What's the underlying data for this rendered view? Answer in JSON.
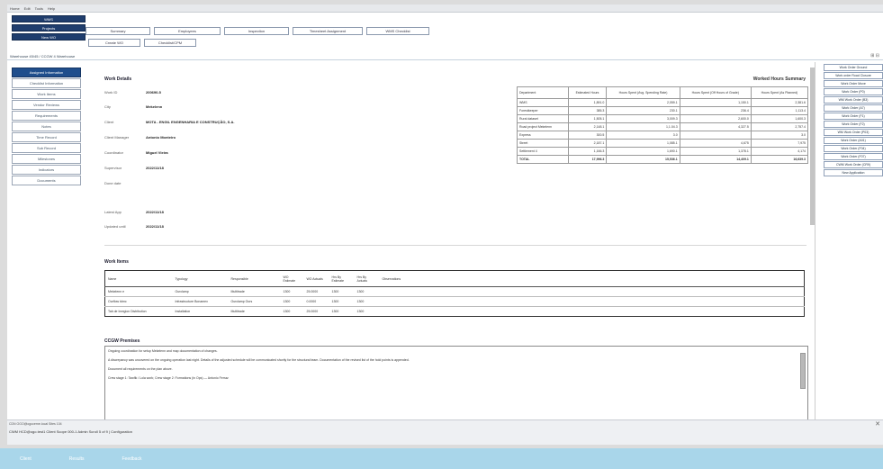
{
  "menubar": [
    "Home",
    "Edit",
    "Tools",
    "Help"
  ],
  "side_top_buttons": [
    "WMS",
    "Projects",
    "New WO"
  ],
  "tabs_row1": [
    "Summary",
    "Employees",
    "Inspection",
    "Timesheet Assignment",
    "WMS Checklist"
  ],
  "tabs_row2": [
    "Create WO",
    "Checklist/CPM"
  ],
  "breadcrumb": "Warehouse 45/45 / CCGW 4 Warehouse",
  "top_right": "⊞ ⊟",
  "leftnav": [
    "Assigned Information",
    "Checklist Information",
    "Work Items",
    "Vendor Reviews",
    "Requirements",
    "Notes",
    "Time Record",
    "Sub Record",
    "Milestones",
    "Indicators",
    "Documents"
  ],
  "work_details": {
    "title": "Work Details",
    "fields": [
      {
        "label": "Work ID",
        "value": "200690-5"
      },
      {
        "label": "City",
        "value": "Mekelenn"
      },
      {
        "label": "Client",
        "value": "MOTA - ENGIL ENGENHARIA E CONSTRUÇÃO, S.A."
      },
      {
        "label": "Client Manager",
        "value": "Antonio Monteiro"
      },
      {
        "label": "Coordinator",
        "value": "Miguel Vieira"
      },
      {
        "label": "Supervisor",
        "value": "2022/11/18"
      },
      {
        "label": "Done date",
        "value": ""
      },
      {
        "label": "Latest App",
        "value": "2022/11/18"
      },
      {
        "label": "Updated until",
        "value": "2022/11/18"
      }
    ]
  },
  "hours_summary": {
    "title": "Worked Hours Summary",
    "headers": [
      "Department",
      "Estimated Hours",
      "Hours Spent (Avg. Spending Rate)",
      "Hours Spent (Off Hours of Grade)",
      "Hours Spent (As Planned)"
    ],
    "rows": [
      [
        "WMS",
        "1,891.0",
        "2,059.1",
        "1,150.1",
        "2,381.6"
      ],
      [
        "Forestkeeper",
        "385.3",
        "230.1",
        "236.4",
        "1,113.4"
      ],
      [
        "Rural dataset",
        "1,505.1",
        "3,009.3",
        "2,600.0",
        "1,600.3"
      ],
      [
        "Road project Mekelenn",
        "2,148.1",
        "1,1.04.3",
        "4,327.5",
        "2,757.4"
      ],
      [
        "Express",
        "300.5",
        "3.0",
        "",
        "3.0"
      ],
      [
        "Street",
        "2,187.1",
        "1,085.1",
        "4,675",
        "7,975"
      ],
      [
        "Settlement 4",
        "1,166.3",
        "1,690.1",
        "1,378.1",
        "4,174"
      ],
      [
        "TOTAL",
        "17,996.3",
        "15,536.1",
        "14,409.1",
        "16,639.3"
      ]
    ]
  },
  "work_items": {
    "title": "Work Items",
    "headers": [
      "Name",
      "Typology",
      "Responsible",
      "WO Estimate",
      "WO Actuals",
      "Hrs By Estimate",
      "Hrs By Actuals",
      "Observations"
    ],
    "rows": [
      [
        "Mekelenn e",
        "Ourclamp",
        "Multitrade",
        "1300",
        "25.0000",
        "1300",
        "1300",
        ""
      ],
      [
        "Ourflow tdmc",
        "Infrastructure Bonamex",
        "Ourclamp Ours",
        "1300",
        "0.0000",
        "1300",
        "1300",
        ""
      ],
      [
        "Tab de Inregion Distribution",
        "Installation",
        "Multitrade",
        "1300",
        "25.0000",
        "1300",
        "1300",
        ""
      ]
    ]
  },
  "cpm_remarks": {
    "title": "CCGW Premises",
    "paragraphs": [
      "Ongoing coordination for setup Mekelenn and map documentation of changes.",
      "A discrepancy was uncovered on the ongoing operation last night. Details of the adjusted schedule will be communicated shortly for the structural team. Documentation of the revised list of the hold points is appended.",
      "Document all requirements on the plan above.",
      "Crew stage 1: Tawfik / Lola work; Crew stage 2: Formations (in Ops) — Antonio Ferraz"
    ]
  },
  "right_panel": [
    "Work Order Ground",
    "Work order Road Closure",
    "Work Order Move",
    "Work Order (P0)",
    "WM Work Order (B3)",
    "Work Order (A7)",
    "Work Order (F1)",
    "Work Order (F2)",
    "WM Work Order (P03)",
    "Work Order (A01)",
    "Work Order (F04)",
    "Work Order (F07)",
    "CWM Work Order (CR9)",
    "New Application"
  ],
  "status": {
    "line1": "CDN OGO@ogocerne.local  Sites 104",
    "line2": "CWM HCD@ogo.test1 Client Scope 000-1 Admin Scroll 5 of 9 | Configuration",
    "close": "✕"
  },
  "taskbar": [
    "Client",
    "Results",
    "Feedback"
  ]
}
